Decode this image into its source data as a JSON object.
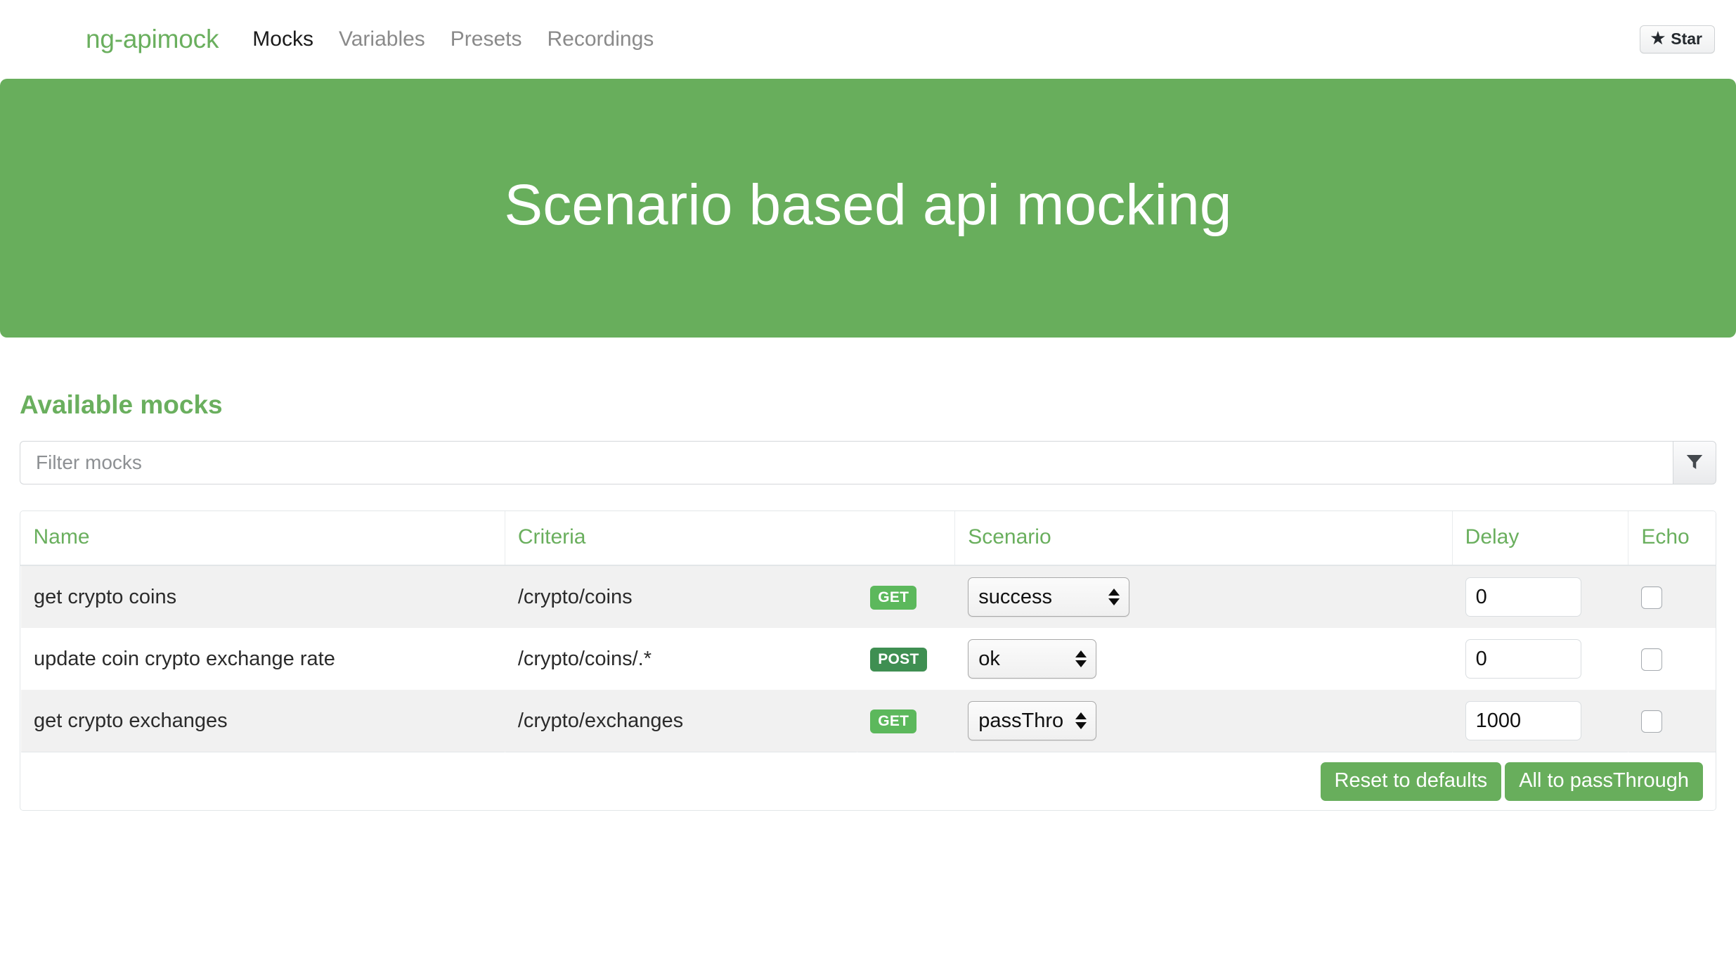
{
  "navbar": {
    "brand": "ng-apimock",
    "links": [
      {
        "label": "Mocks",
        "active": true
      },
      {
        "label": "Variables",
        "active": false
      },
      {
        "label": "Presets",
        "active": false
      },
      {
        "label": "Recordings",
        "active": false
      }
    ],
    "star_button": {
      "label": "Star",
      "icon": "star-icon",
      "glyph": "★"
    }
  },
  "hero": {
    "title": "Scenario based api mocking",
    "background_color": "#68ae5c"
  },
  "main": {
    "section_title": "Available mocks",
    "accent_color": "#6aaf5e",
    "filter": {
      "value": "",
      "placeholder": "Filter mocks",
      "button_icon": "funnel-icon"
    },
    "table": {
      "columns": [
        "Name",
        "Criteria",
        "Scenario",
        "Delay",
        "Echo"
      ],
      "rows": [
        {
          "name": "get crypto coins",
          "criteria": "/crypto/coins",
          "method": "GET",
          "method_style": "get",
          "scenario": "success",
          "delay": "0",
          "echo": false
        },
        {
          "name": "update coin crypto exchange rate",
          "criteria": "/crypto/coins/.*",
          "method": "POST",
          "method_style": "post",
          "scenario": "ok",
          "delay": "0",
          "echo": false
        },
        {
          "name": "get crypto exchanges",
          "criteria": "/crypto/exchanges",
          "method": "GET",
          "method_style": "get",
          "scenario": "passThrough",
          "delay": "1000",
          "echo": false
        }
      ],
      "footer": {
        "reset_label": "Reset to defaults",
        "passthrough_label": "All to passThrough"
      }
    }
  }
}
